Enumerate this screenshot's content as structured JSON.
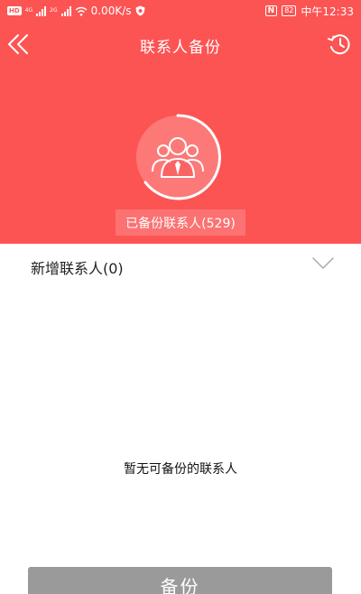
{
  "status_bar": {
    "hd": "HD",
    "signal1_label": "4G",
    "signal2_label": "2G",
    "speed": "0.00K/s",
    "nfc": "N",
    "battery": "82",
    "time": "中午12:33"
  },
  "header": {
    "title": "联系人备份"
  },
  "summary": {
    "backed_up_label": "已备份联系人(529)"
  },
  "new_contacts": {
    "label": "新增联系人(0)"
  },
  "empty_state": {
    "message": "暂无可备份的联系人"
  },
  "backup_button": {
    "label": "备份"
  },
  "colors": {
    "brand_red": "#fc5453",
    "button_disabled": "#9a9a9a"
  }
}
